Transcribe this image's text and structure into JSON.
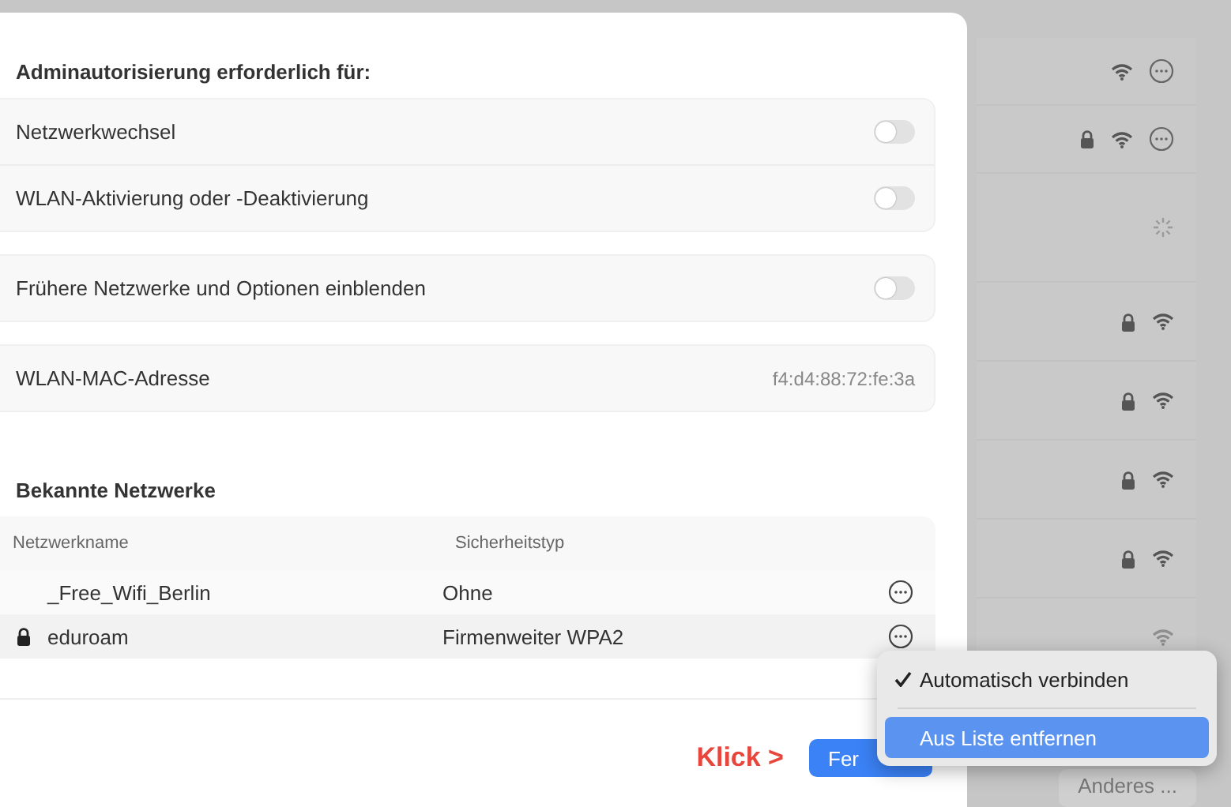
{
  "admin_section": {
    "title": "Adminautorisierung erforderlich für:"
  },
  "setting_groups": [
    {
      "rows": [
        {
          "kind": "toggle",
          "label": "Netzwerkwechsel",
          "on": false
        },
        {
          "kind": "toggle",
          "label": "WLAN-Aktivierung oder -Deaktivierung",
          "on": false
        }
      ]
    },
    {
      "rows": [
        {
          "kind": "toggle",
          "label": "Frühere Netzwerke und Optionen einblenden",
          "on": false
        }
      ]
    },
    {
      "rows": [
        {
          "kind": "value",
          "label": "WLAN-MAC-Adresse",
          "value": "f4:d4:88:72:fe:3a"
        }
      ]
    }
  ],
  "known_networks": {
    "title": "Bekannte Netzwerke",
    "columns": [
      "Netzwerkname",
      "Sicherheitstyp"
    ],
    "rows": [
      {
        "name": "_Free_Wifi_Berlin",
        "security": "Ohne",
        "locked": false
      },
      {
        "name": "eduroam",
        "security": "Firmenweiter WPA2",
        "locked": true
      }
    ]
  },
  "footer": {
    "annotation": "Klick >",
    "button": "Fer"
  },
  "background_list": {
    "rows": [
      {
        "kind": "network",
        "locked": false,
        "more": true
      },
      {
        "kind": "network",
        "locked": true,
        "more": true
      },
      {
        "kind": "loading"
      },
      {
        "kind": "network",
        "locked": true,
        "more": false
      },
      {
        "kind": "network",
        "locked": true,
        "more": false
      },
      {
        "kind": "network",
        "locked": true,
        "more": false
      },
      {
        "kind": "network",
        "locked": true,
        "more": false
      },
      {
        "kind": "network",
        "locked": false,
        "more": false
      }
    ],
    "other_button": "Anderes ..."
  },
  "context_menu": {
    "items": [
      {
        "label": "Automatisch verbinden",
        "checked": true,
        "selected": false
      },
      {
        "label": "Aus Liste entfernen",
        "checked": false,
        "selected": true
      }
    ]
  }
}
